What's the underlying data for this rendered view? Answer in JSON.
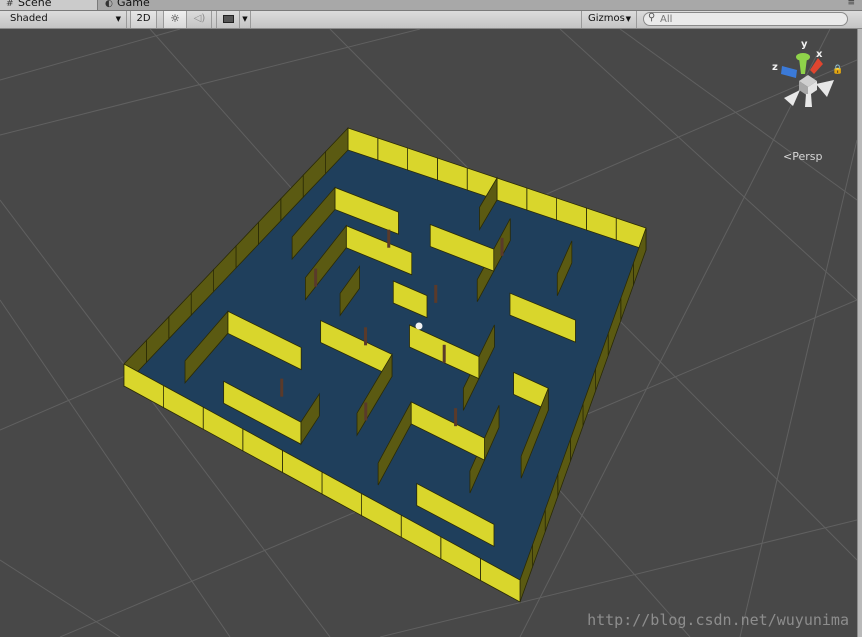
{
  "tabs": [
    {
      "label": "Scene",
      "icon": "scene-icon",
      "active": true
    },
    {
      "label": "Game",
      "icon": "game-icon",
      "active": false
    }
  ],
  "toolbar": {
    "draw_mode": "Shaded",
    "mode_2d": "2D",
    "lighting_icon": "sun-icon",
    "audio_icon": "speaker-icon",
    "effects_icon": "image-icon",
    "gizmos_label": "Gizmos",
    "search_placeholder": "All"
  },
  "gizmo": {
    "axis_x": "x",
    "axis_y": "y",
    "axis_z": "z",
    "projection": "Persp",
    "colors": {
      "x": "#e0452f",
      "y": "#8fd34a",
      "z": "#3b7ad8",
      "neutral": "#e8e8e8"
    }
  },
  "scene": {
    "floor_color": "#1f3f5c",
    "wall_color": "#d9d62c",
    "wall_shade": "#5b5a12",
    "post_color": "#5a3a2a",
    "grid_color": "#606060",
    "background": "#484848"
  },
  "watermark": "http://blog.csdn.net/wuyunima"
}
